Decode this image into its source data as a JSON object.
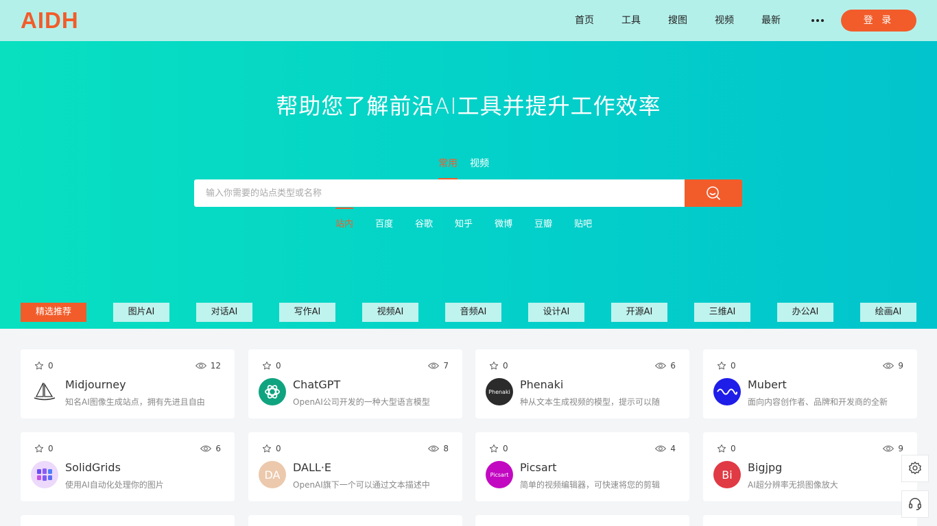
{
  "logo": "AIDH",
  "nav": {
    "items": [
      "首页",
      "工具",
      "搜图",
      "视频",
      "最新"
    ],
    "login": "登 录"
  },
  "hero": {
    "title": "帮助您了解前沿AI工具并提升工作效率",
    "tabs": [
      "常用",
      "视频"
    ],
    "search_placeholder": "输入你需要的站点类型或名称",
    "engines": [
      "站内",
      "百度",
      "谷歌",
      "知乎",
      "微博",
      "豆瓣",
      "贴吧"
    ]
  },
  "categories": [
    "精选推荐",
    "图片AI",
    "对话AI",
    "写作AI",
    "视频AI",
    "音频AI",
    "设计AI",
    "开源AI",
    "三维AI",
    "办公AI",
    "绘画AI"
  ],
  "cards": [
    {
      "stars": "0",
      "views": "12",
      "name": "Midjourney",
      "desc": "知名AI图像生成站点，拥有先进且自由"
    },
    {
      "stars": "0",
      "views": "7",
      "name": "ChatGPT",
      "desc": "OpenAI公司开发的一种大型语言模型"
    },
    {
      "stars": "0",
      "views": "6",
      "name": "Phenaki",
      "desc": "种从文本生成视频的模型，提示可以随",
      "logo_text": "Phenaki"
    },
    {
      "stars": "0",
      "views": "9",
      "name": "Mubert",
      "desc": "面向内容创作者、品牌和开发商的全新"
    },
    {
      "stars": "0",
      "views": "6",
      "name": "SolidGrids",
      "desc": "使用AI自动化处理你的图片"
    },
    {
      "stars": "0",
      "views": "8",
      "name": "DALL·E",
      "desc": "OpenAI旗下一个可以通过文本描述中",
      "logo_text": "DA"
    },
    {
      "stars": "0",
      "views": "4",
      "name": "Picsart",
      "desc": "简单的视频编辑器，可快速将您的剪辑",
      "logo_text": "Picsart"
    },
    {
      "stars": "0",
      "views": "9",
      "name": "Bigjpg",
      "desc": "AI超分辨率无损图像放大",
      "logo_text": "Bi"
    }
  ],
  "colors": {
    "accent": "#f25c2a",
    "teal": "#03cfca"
  }
}
